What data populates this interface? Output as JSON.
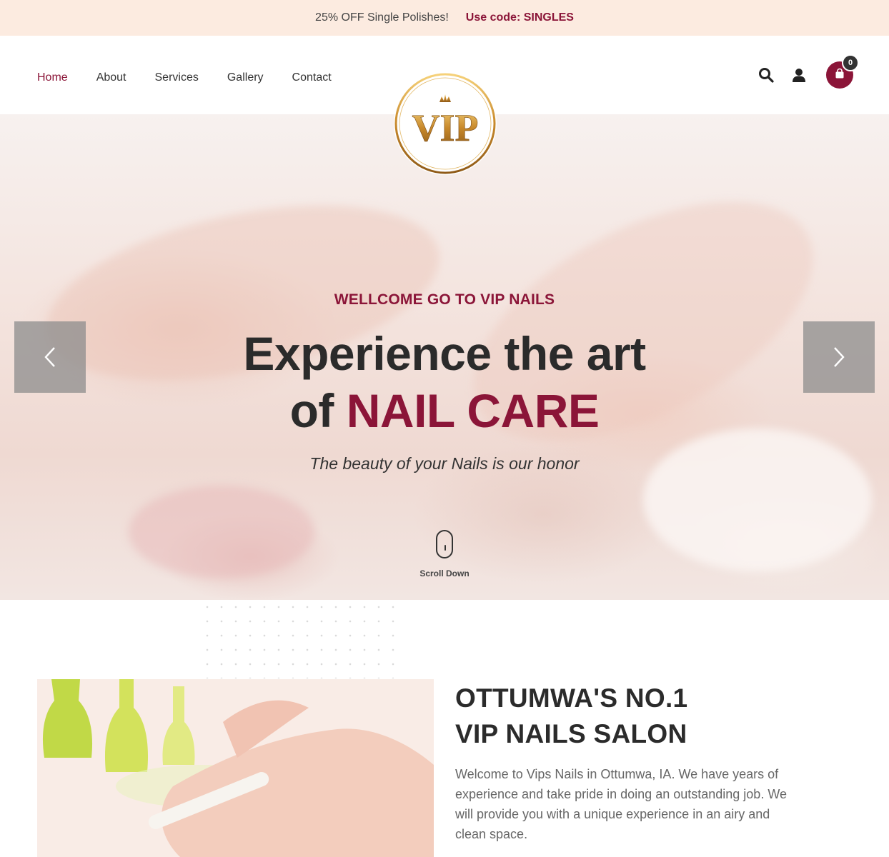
{
  "promo": {
    "offer": "25% OFF Single Polishes!",
    "code": "Use code: SINGLES"
  },
  "nav": {
    "items": [
      "Home",
      "About",
      "Services",
      "Gallery",
      "Contact"
    ],
    "active": "Home"
  },
  "logo": {
    "text": "VIP",
    "crown_icon": "crown-icon"
  },
  "header_tools": {
    "search_icon": "search-icon",
    "account_icon": "user-icon",
    "cart_icon": "shopping-bag-icon",
    "cart_count": "0"
  },
  "hero": {
    "eyebrow": "WELLCOME GO TO VIP NAILS",
    "headline_line1": "Experience the art",
    "headline_line2_prefix": "of",
    "headline_line2_accent": "NAIL CARE",
    "tagline": "The beauty of your Nails is our honor",
    "scroll_label": "Scroll Down",
    "prev_icon": "chevron-left-icon",
    "next_icon": "chevron-right-icon"
  },
  "about": {
    "title_line1": "OTTUMWA'S NO.1",
    "title_line2": "VIP NAILS SALON",
    "body": "Welcome to Vips Nails in Ottumwa, IA. We have years of experience and take pride in doing an outstanding job. We will provide you with a unique experience in an airy and clean space."
  },
  "colors": {
    "brand": "#8b1538",
    "promo_bg": "#fcebe0",
    "gold": "#d4a24c",
    "dark_text": "#2b2b2b"
  }
}
